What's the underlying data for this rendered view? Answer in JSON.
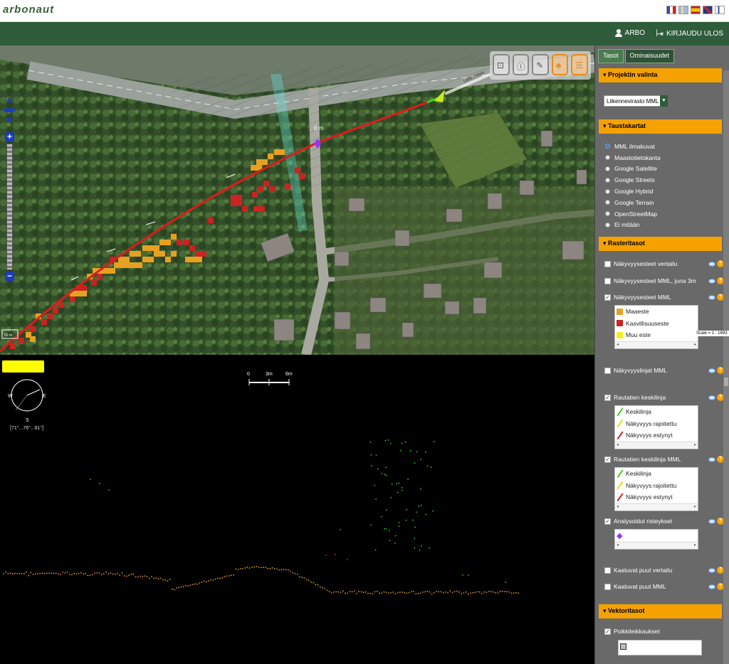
{
  "app": {
    "logo": "arbonaut"
  },
  "flags": [
    "flag-france-icon",
    "flag-sweden-icon",
    "flag-spain-icon",
    "flag-uk-icon",
    "flag-finland-icon"
  ],
  "nav": {
    "user": "ARBO",
    "separator": "|",
    "logout": "KIRJAUDU ULOS"
  },
  "map": {
    "distance_label": "0 m",
    "street_label": "Lahti-Helsin",
    "small_scale": "50 m"
  },
  "profile": {
    "compass_w": "W",
    "compass_e": "E",
    "compass_s": "S",
    "compass_range": "[71°...76°...81°]",
    "scale_labels": [
      "0",
      "3m",
      "6m"
    ]
  },
  "panel": {
    "tabs": [
      {
        "label": "Tasot",
        "active": true
      },
      {
        "label": "Ominaisuudet",
        "active": false
      }
    ],
    "projection": {
      "title": "Projektin valinta",
      "selected": "Liikennevirasto MML"
    },
    "background": {
      "title": "Taustakartat",
      "items": [
        {
          "label": "MML ilmakuvat",
          "selected": true
        },
        {
          "label": "Maastotietokanta",
          "selected": false
        },
        {
          "label": "Google Satellite",
          "selected": false
        },
        {
          "label": "Google Streets",
          "selected": false
        },
        {
          "label": "Google Hybrid",
          "selected": false
        },
        {
          "label": "Google Terrain",
          "selected": false
        },
        {
          "label": "OpenStreetMap",
          "selected": false
        },
        {
          "label": "Ei mitään",
          "selected": false
        }
      ]
    },
    "raster": {
      "title": "Rasteritasot",
      "layers": [
        {
          "label": "Näkyvyysesteet vertailu",
          "checked": false
        },
        {
          "label": "Näkyvyysesteet MML, juna 3m",
          "checked": false
        },
        {
          "label": "Näkyvyysesteet MML",
          "checked": true
        },
        {
          "label": "Näkyvyyslinjat MML",
          "checked": false
        },
        {
          "label": "Rautatien keskilinja",
          "checked": true
        },
        {
          "label": "Rautatien keskilinja MML",
          "checked": true
        },
        {
          "label": "Analysoidut risteykset",
          "checked": true
        },
        {
          "label": "Kaatuvat puut vertailu",
          "checked": false
        },
        {
          "label": "Kaatuvat puut MML",
          "checked": false
        }
      ],
      "legend_obstacles": [
        {
          "label": "Maaeste",
          "color": "#e8a020"
        },
        {
          "label": "Kasvillisuuseste",
          "color": "#cc2222"
        },
        {
          "label": "Muu este",
          "color": "#f0f020"
        }
      ],
      "legend_centerline": [
        {
          "label": "Keskilinja",
          "color": "#44cc22"
        },
        {
          "label": "Näkyvyys rajoitettu",
          "color": "#e0e020"
        },
        {
          "label": "Näkyvyys estynyt",
          "color": "#cc2222"
        }
      ],
      "legend_centerline_mml": [
        {
          "label": "Keskilinja",
          "color": "#44cc22"
        },
        {
          "label": "Näkyvyys rajoitettu",
          "color": "#e0e020"
        },
        {
          "label": "Näkyvyys estynyt",
          "color": "#cc2222"
        }
      ],
      "crossing_color": "#9933ff"
    },
    "vector": {
      "title": "Vektoritasot",
      "layer": "Poikkileikkaukset"
    },
    "scale": "Scale = 1 : 1693"
  }
}
